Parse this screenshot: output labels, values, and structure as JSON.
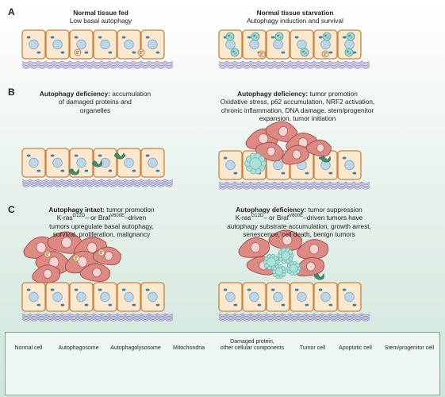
{
  "panels": {
    "a": {
      "letter": "A",
      "left_title": "Normal tissue fed",
      "left_sub": "Low basal autophagy",
      "right_title": "Normal tissue starvation",
      "right_sub": "Autophagy induction and survival"
    },
    "b": {
      "letter": "B",
      "left_bold": "Autophagy deficiency:",
      "left_text_1": " accumulation",
      "left_text_2": "of damaged proteins and",
      "left_text_3": "organelles",
      "right_bold": "Autophagy deficiency:",
      "right_text_1": " tumor promotion",
      "right_text_2": "Oxidative stress, p62 accumulation, NRF2 activation,",
      "right_text_3": "chronic inflammation, DNA damage, stem/progenitor",
      "right_text_4": "expansion, tumor initiation"
    },
    "c": {
      "letter": "C",
      "left_bold": "Autophagy intact:",
      "left_text_1": " tumor promotion",
      "left_gene_pre": "K-ras",
      "left_gene_sup1": "G12D",
      "left_gene_mid": "– or Braf",
      "left_gene_sup2": "V600E",
      "left_gene_post": "–driven",
      "left_text_3": "tumors upregulate basal autophagy,",
      "left_text_4": "survival, proliferation, malignancy",
      "right_bold": "Autophagy deficiency:",
      "right_text_1": " tumor suppression",
      "right_gene_pre": "K-ras",
      "right_gene_sup1": "G12D",
      "right_gene_mid": "– or Braf",
      "right_gene_sup2": "V600E",
      "right_gene_post": "–driven tumors have",
      "right_text_3": "autophagy substrate accumulation, growth arrest,",
      "right_text_4": "senescence, cell death, benign tumors"
    }
  },
  "legend": {
    "normal_cell": "Normal cell",
    "autophagosome": "Autophagosome",
    "autophagolysosome": "Autophagolysosome",
    "mitochondria": "Mitochondria",
    "damaged_1": "Damaged protein,",
    "damaged_2": "other cellular components",
    "tumor_cell": "Tumor cell",
    "apoptotic_cell": "Apoptotic cell",
    "stem_cell": "Stem/progenitor cell"
  },
  "colors": {
    "cell_fill": "#fae9cf",
    "cell_stroke": "#c9823d",
    "nucleus": "#bcd6ea",
    "tumor": "#dd8a85",
    "autophagosome": "#9fd8d3",
    "fibers": "#8c7bbf"
  }
}
